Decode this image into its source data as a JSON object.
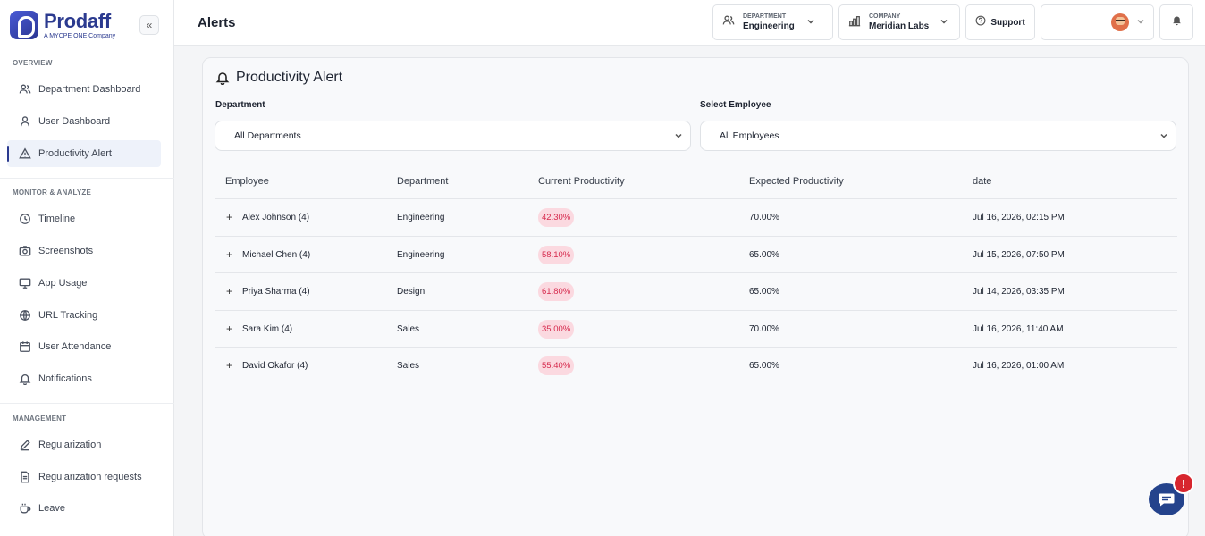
{
  "brand": {
    "name": "Prodaff",
    "tagline": "A MYCPE ONE Company",
    "collapse_glyph": "«"
  },
  "sidebar": {
    "sections": [
      {
        "label": "OVERVIEW"
      },
      {
        "label": "MONITOR & ANALYZE"
      },
      {
        "label": "MANAGEMENT"
      }
    ],
    "items": [
      {
        "label": "Department Dashboard",
        "icon": "users-icon"
      },
      {
        "label": "User Dashboard",
        "icon": "user-icon"
      },
      {
        "label": "Productivity Alert",
        "icon": "warning-triangle-icon",
        "active": true
      },
      {
        "label": "Timeline",
        "icon": "clock-icon"
      },
      {
        "label": "Screenshots",
        "icon": "camera-icon"
      },
      {
        "label": "App Usage",
        "icon": "monitor-icon"
      },
      {
        "label": "URL Tracking",
        "icon": "globe-icon"
      },
      {
        "label": "User Attendance",
        "icon": "calendar-icon"
      },
      {
        "label": "Notifications",
        "icon": "bell-icon"
      },
      {
        "label": "Regularization",
        "icon": "pencil-icon"
      },
      {
        "label": "Regularization requests",
        "icon": "document-icon"
      },
      {
        "label": "Leave",
        "icon": "coffee-cup-icon"
      }
    ]
  },
  "header": {
    "title": "Alerts",
    "department": {
      "label": "DEPARTMENT",
      "value": "Engineering"
    },
    "company": {
      "label": "COMPANY",
      "value": "Meridian Labs"
    },
    "support_label": "Support"
  },
  "main": {
    "title": "Productivity Alert",
    "department_filter": {
      "label": "Department",
      "value": "All Departments"
    },
    "employee_filter": {
      "label": "Select Employee",
      "value": "All Employees"
    },
    "table": {
      "columns": [
        "Employee",
        "Department",
        "Current Productivity",
        "Expected Productivity",
        "date"
      ],
      "rows": [
        {
          "employee": "Alex Johnson (4)",
          "department": "Engineering",
          "current": "42.30%",
          "expected": "70.00%",
          "date": "Jul 16, 2026, 02:15 PM"
        },
        {
          "employee": "Michael Chen (4)",
          "department": "Engineering",
          "current": "58.10%",
          "expected": "65.00%",
          "date": "Jul 15, 2026, 07:50 PM"
        },
        {
          "employee": "Priya Sharma (4)",
          "department": "Design",
          "current": "61.80%",
          "expected": "65.00%",
          "date": "Jul 14, 2026, 03:35 PM"
        },
        {
          "employee": "Sara Kim (4)",
          "department": "Sales",
          "current": "35.00%",
          "expected": "70.00%",
          "date": "Jul 16, 2026, 11:40 AM"
        },
        {
          "employee": "David Okafor (4)",
          "department": "Sales",
          "current": "55.40%",
          "expected": "65.00%",
          "date": "Jul 16, 2026, 01:00 AM"
        }
      ],
      "expand_glyph": "+"
    }
  },
  "chat": {
    "badge": "!"
  },
  "colors": {
    "brand": "#2b3a8f",
    "alert_badge_bg": "#fbd9e0",
    "alert_badge_text": "#d62a4d",
    "chat": "#24438c"
  }
}
